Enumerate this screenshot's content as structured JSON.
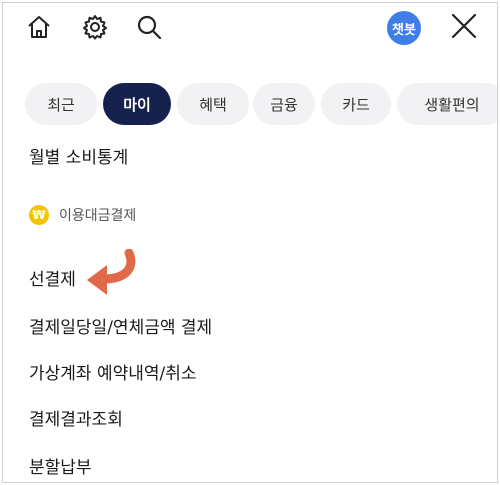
{
  "header": {
    "icons": [
      "home-icon",
      "gear-icon",
      "search-icon",
      "close-icon"
    ],
    "chatbot_label": "챗봇"
  },
  "tabs": [
    {
      "label": "최근"
    },
    {
      "label": "마이"
    },
    {
      "label": "혜택"
    },
    {
      "label": "금융"
    },
    {
      "label": "카드"
    },
    {
      "label": "생활편의"
    }
  ],
  "active_tab": "마이",
  "menu": {
    "item_top": "월별 소비통계",
    "section_title": "이용대금결제",
    "items": [
      {
        "label": "선결제"
      },
      {
        "label": "결제일당일/연체금액 결제"
      },
      {
        "label": "가상계좌 예약내역/취소"
      },
      {
        "label": "결제결과조회"
      },
      {
        "label": "분할납부"
      }
    ]
  },
  "colors": {
    "accent_tab": "#17214d",
    "chatbot": "#3f7ee8",
    "won_badge": "#f5c400",
    "arrow": "#e0694a"
  }
}
